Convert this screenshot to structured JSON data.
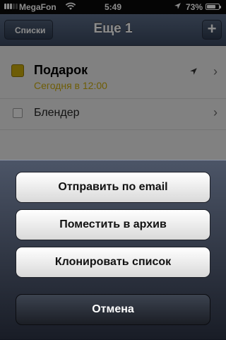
{
  "status_bar": {
    "carrier": "MegaFon",
    "time": "5:49",
    "battery_percent": "73%",
    "battery_level": 0.73
  },
  "navbar": {
    "back_label": "Списки",
    "title": "Еще 1",
    "add_label": "+"
  },
  "tasks": [
    {
      "title": "Подарок",
      "subtitle": "Сегодня в 12:00"
    },
    {
      "title": "Блендер"
    }
  ],
  "action_sheet": {
    "email_label": "Отправить по email",
    "archive_label": "Поместить в архив",
    "clone_label": "Клонировать список",
    "cancel_label": "Отмена"
  },
  "colors": {
    "accent_yellow": "#c9a90b",
    "nav_blue": "#4a5a74"
  }
}
